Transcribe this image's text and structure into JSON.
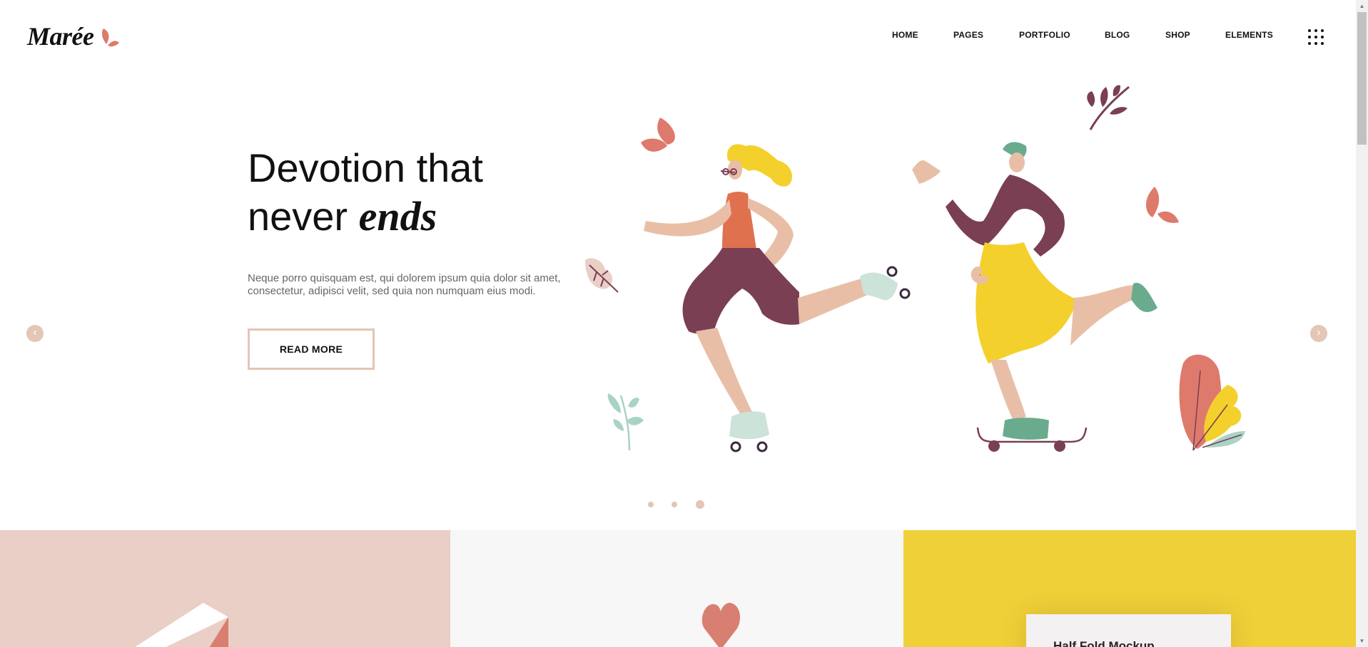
{
  "brand": {
    "name": "Marée"
  },
  "nav": {
    "items": [
      {
        "label": "HOME",
        "active": true
      },
      {
        "label": "PAGES"
      },
      {
        "label": "PORTFOLIO"
      },
      {
        "label": "BLOG"
      },
      {
        "label": "SHOP"
      },
      {
        "label": "ELEMENTS"
      }
    ],
    "menu_icon": "grid-menu-icon"
  },
  "hero": {
    "title_line1": "Devotion that",
    "title_line2_plain": "never",
    "title_line2_emph": "ends",
    "text_line1": "Neque porro quisquam est, qui dolorem ipsum quia dolor sit amet,",
    "text_line2": "consectetur, adipisci velit, sed quia non numquam eius modi.",
    "cta": "READ MORE",
    "prev_icon": "chevron-left-icon",
    "next_icon": "chevron-right-icon",
    "slides": 3,
    "active_slide": 3
  },
  "panels": {
    "mockup_title": "Half Fold Mockup"
  },
  "colors": {
    "accent": "#e3c6b5",
    "pink_panel": "#eacfc6",
    "grey_panel": "#f7f7f7",
    "yellow_panel": "#f0d038",
    "coral": "#de7a6c",
    "plum": "#7a3f52",
    "yellow": "#f4d02c",
    "mint": "#6aab8e"
  }
}
